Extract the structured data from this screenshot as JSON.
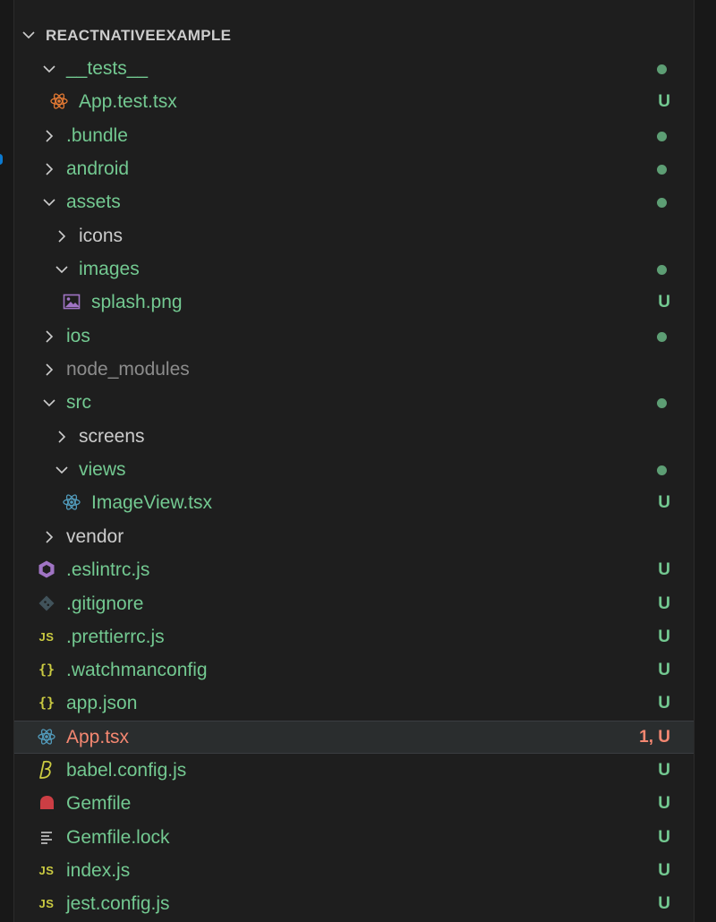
{
  "explorer": {
    "folder_title": "REACTNATIVEEXAMPLE"
  },
  "colors": {
    "untracked": "#73c991",
    "error": "#f48771",
    "default_text": "#cccccc",
    "ignored": "#8c8c8c",
    "selected_row": "#2a2d2e"
  },
  "tree": {
    "tests_folder": {
      "label": "__tests__",
      "icon": "chevron-down-icon"
    },
    "app_test": {
      "label": "App.test.tsx",
      "status": "U",
      "icon": "react-icon"
    },
    "bundle_folder": {
      "label": ".bundle",
      "icon": "chevron-right-icon"
    },
    "android_folder": {
      "label": "android",
      "icon": "chevron-right-icon"
    },
    "assets_folder": {
      "label": "assets",
      "icon": "chevron-down-icon"
    },
    "icons_folder": {
      "label": "icons",
      "icon": "chevron-right-icon"
    },
    "images_folder": {
      "label": "images",
      "icon": "chevron-down-icon"
    },
    "splash_png": {
      "label": "splash.png",
      "status": "U",
      "icon": "image-file-icon"
    },
    "ios_folder": {
      "label": "ios",
      "icon": "chevron-right-icon"
    },
    "node_modules_folder": {
      "label": "node_modules",
      "icon": "chevron-right-icon"
    },
    "src_folder": {
      "label": "src",
      "icon": "chevron-down-icon"
    },
    "screens_folder": {
      "label": "screens",
      "icon": "chevron-right-icon"
    },
    "views_folder": {
      "label": "views",
      "icon": "chevron-down-icon"
    },
    "imageview_tsx": {
      "label": "ImageView.tsx",
      "status": "U",
      "icon": "react-icon"
    },
    "vendor_folder": {
      "label": "vendor",
      "icon": "chevron-right-icon"
    },
    "eslintrc": {
      "label": ".eslintrc.js",
      "status": "U",
      "icon": "eslint-icon"
    },
    "gitignore": {
      "label": ".gitignore",
      "status": "U",
      "icon": "git-icon"
    },
    "prettierrc": {
      "label": ".prettierrc.js",
      "status": "U",
      "icon": "js-icon",
      "icon_text": "JS"
    },
    "watchmanconfig": {
      "label": ".watchmanconfig",
      "status": "U",
      "icon": "json-icon",
      "icon_text": "{}"
    },
    "app_json": {
      "label": "app.json",
      "status": "U",
      "icon": "json-icon",
      "icon_text": "{}"
    },
    "app_tsx": {
      "label": "App.tsx",
      "status": "1, U",
      "icon": "react-icon"
    },
    "babel_config": {
      "label": "babel.config.js",
      "status": "U",
      "icon": "babel-icon"
    },
    "gemfile": {
      "label": "Gemfile",
      "status": "U",
      "icon": "ruby-icon"
    },
    "gemfile_lock": {
      "label": "Gemfile.lock",
      "status": "U",
      "icon": "lines-icon"
    },
    "index_js": {
      "label": "index.js",
      "status": "U",
      "icon": "js-icon",
      "icon_text": "JS"
    },
    "jest_config": {
      "label": "jest.config.js",
      "status": "U",
      "icon": "js-icon",
      "icon_text": "JS"
    }
  }
}
